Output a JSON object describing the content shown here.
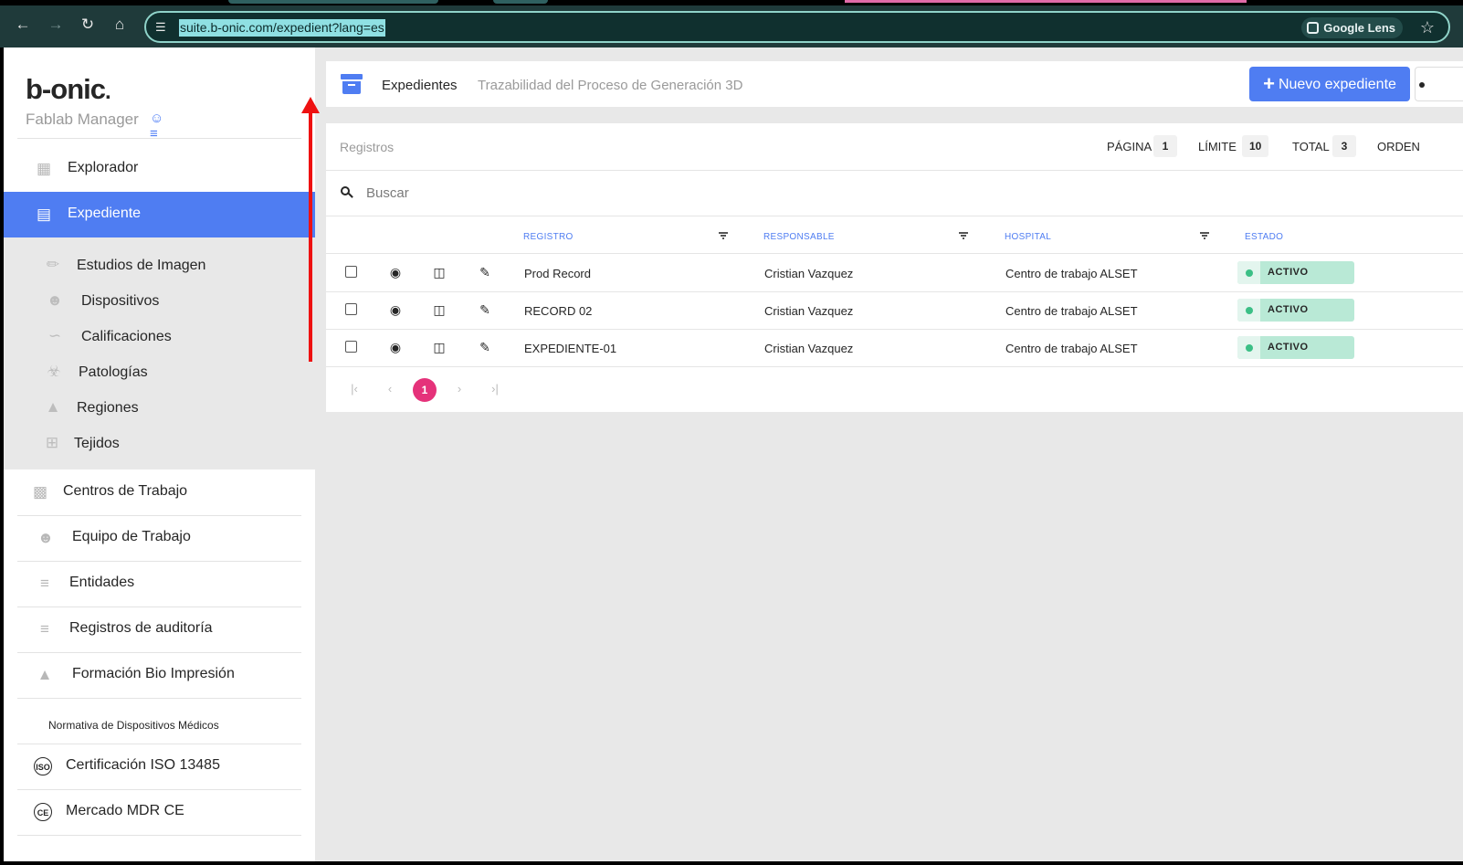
{
  "browser": {
    "url": "suite.b-onic.com/expedient?lang=es",
    "lens_label": "Google Lens"
  },
  "brand": {
    "logo": "b-onic",
    "subtitle": "Fablab Manager"
  },
  "sidebar": {
    "items": [
      {
        "label": "Explorador",
        "icon": "grid-icon"
      },
      {
        "label": "Expediente",
        "icon": "archive-icon",
        "active": true
      }
    ],
    "subitems": [
      {
        "label": "Estudios de Imagen",
        "icon": "ruler-icon"
      },
      {
        "label": "Dispositivos",
        "icon": "users-icon"
      },
      {
        "label": "Calificaciones",
        "icon": "signature-icon"
      },
      {
        "label": "Patologías",
        "icon": "biohazard-icon"
      },
      {
        "label": "Regiones",
        "icon": "shapes-icon"
      },
      {
        "label": "Tejidos",
        "icon": "crop-icon"
      }
    ],
    "items2": [
      {
        "label": "Centros de Trabajo",
        "icon": "building-icon"
      },
      {
        "label": "Equipo de Trabajo",
        "icon": "team-icon"
      },
      {
        "label": "Entidades",
        "icon": "layers-icon"
      },
      {
        "label": "Registros de auditoría",
        "icon": "layers-icon"
      },
      {
        "label": "Formación Bio Impresión",
        "icon": "graduation-cap-icon"
      }
    ],
    "section_label": "Normativa de Dispositivos Médicos",
    "items3": [
      {
        "label": "Certificación ISO 13485",
        "icon": "iso-icon",
        "glyph": "ISO"
      },
      {
        "label": "Mercado MDR CE",
        "icon": "ce-icon",
        "glyph": "CE"
      }
    ]
  },
  "header": {
    "title": "Expedientes",
    "subtitle": "Trazabilidad del Proceso de Generación 3D",
    "new_button": "Nuevo expediente"
  },
  "table": {
    "label": "Registros",
    "pagina_label": "PÁGINA",
    "pagina_value": "1",
    "limite_label": "LÍMITE",
    "limite_value": "10",
    "total_label": "TOTAL",
    "total_value": "3",
    "orden_label": "ORDEN",
    "search_placeholder": "Buscar",
    "columns": [
      "REGISTRO",
      "RESPONSABLE",
      "HOSPITAL",
      "ESTADO"
    ],
    "rows": [
      {
        "registro": "Prod Record",
        "responsable": "Cristian Vazquez",
        "hospital": "Centro de trabajo ALSET",
        "estado": "ACTIVO"
      },
      {
        "registro": "RECORD 02",
        "responsable": "Cristian Vazquez",
        "hospital": "Centro de trabajo ALSET",
        "estado": "ACTIVO"
      },
      {
        "registro": "EXPEDIENTE-01",
        "responsable": "Cristian Vazquez",
        "hospital": "Centro de trabajo ALSET",
        "estado": "ACTIVO"
      }
    ],
    "current_page": "1"
  },
  "colors": {
    "accent": "#4f7df2",
    "status_bg": "#b9e9d6",
    "status_dot": "#3cbf86",
    "page_active": "#e5327a",
    "annotation": "#ee1111"
  }
}
